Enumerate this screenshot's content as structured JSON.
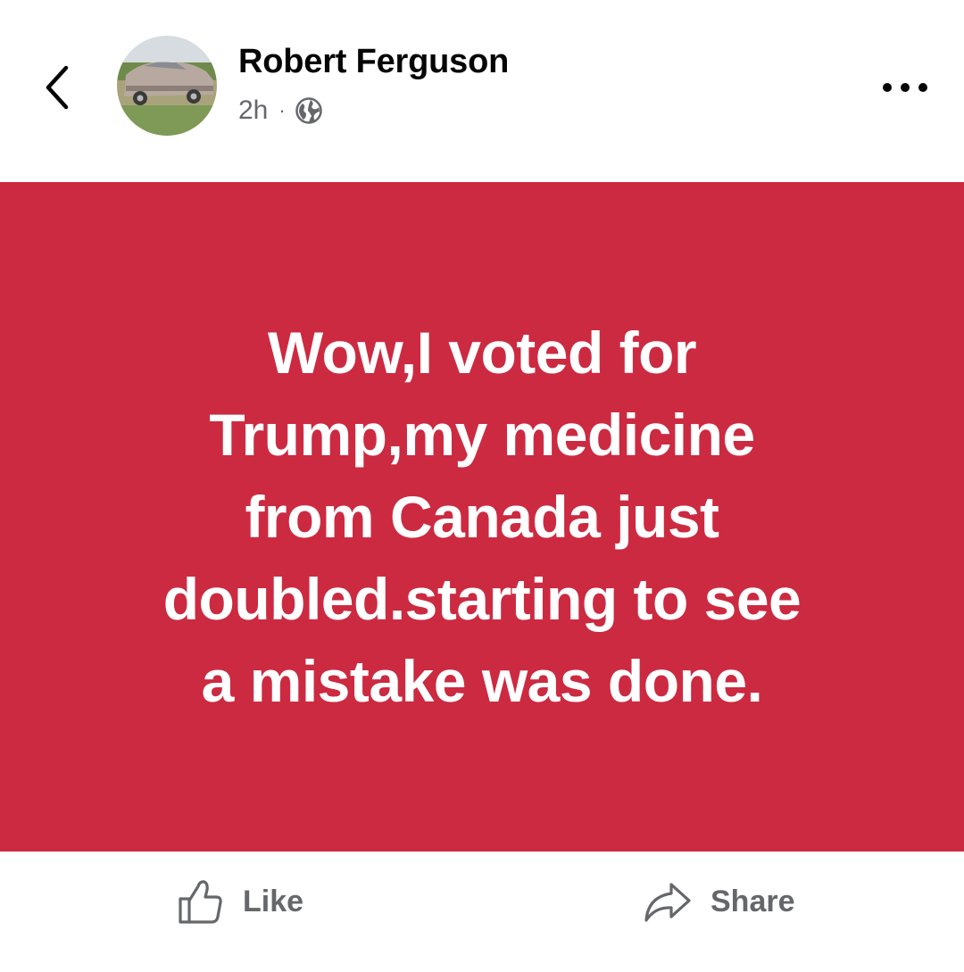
{
  "header": {
    "back_icon": "chevron-left-icon",
    "author_name": "Robert Ferguson",
    "avatar_icon": "profile-photo-car",
    "timestamp": "2h",
    "separator": "·",
    "privacy_icon": "globe-icon",
    "more_icon": "more-horizontal-icon"
  },
  "post": {
    "background_color": "#cc2a41",
    "text_color": "#ffffff",
    "lines": [
      "Wow,I voted for",
      "Trump,my medicine",
      "from Canada just",
      "doubled.starting to see",
      "a mistake was done."
    ]
  },
  "actions": {
    "like": {
      "label": "Like",
      "icon": "thumbs-up-icon"
    },
    "share": {
      "label": "Share",
      "icon": "share-arrow-icon"
    }
  }
}
